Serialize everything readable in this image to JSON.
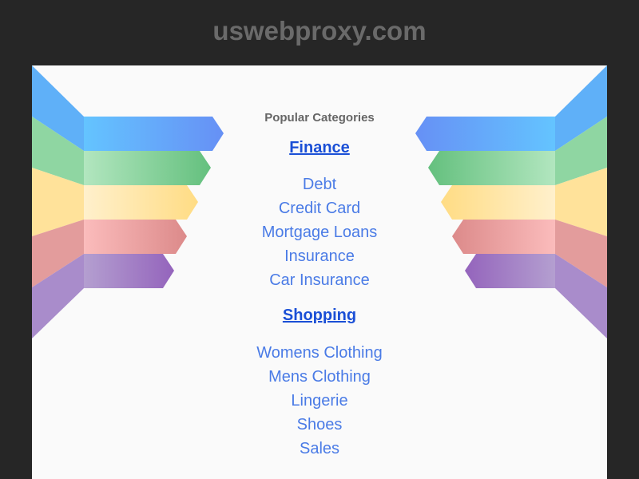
{
  "site": {
    "title": "uswebproxy.com"
  },
  "main": {
    "heading": "Popular Categories",
    "categories": [
      {
        "title": "Finance",
        "links": [
          "Debt",
          "Credit Card",
          "Mortgage Loans",
          "Insurance",
          "Car Insurance"
        ]
      },
      {
        "title": "Shopping",
        "links": [
          "Womens Clothing",
          "Mens Clothing",
          "Lingerie",
          "Shoes",
          "Sales"
        ]
      }
    ]
  },
  "colors": {
    "background": "#262626",
    "panel": "#fafafa",
    "title": "#6a6a6a",
    "category_link": "#1a4fd6",
    "link": "#4a7be6",
    "ribbon_blue": "#64b7ff",
    "ribbon_green": "#6cc784",
    "ribbon_yellow": "#ffdf8a",
    "ribbon_pink": "#e99494",
    "ribbon_purple": "#9b6fc0"
  }
}
